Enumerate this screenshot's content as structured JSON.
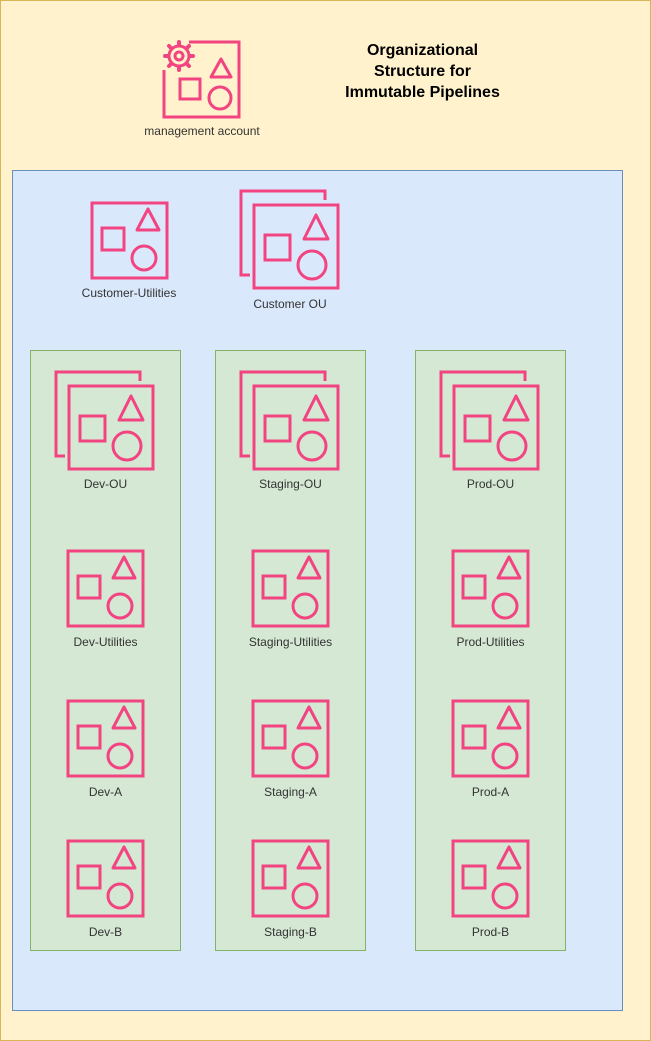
{
  "title": "Organizational Structure for Immutable Pipelines",
  "colors": {
    "outer_fill": "#fff2cc",
    "outer_border": "#d6b656",
    "ou_fill": "#dae8fc",
    "ou_border": "#6c8ebf",
    "column_fill": "#d5e8d4",
    "column_border": "#82b366",
    "icon": "#f34482"
  },
  "management": {
    "label": "management account",
    "icon": "organizations-management-account-icon"
  },
  "customer": {
    "utilities_label": "Customer-Utilities",
    "ou_label": "Customer OU"
  },
  "columns": [
    {
      "ou": "Dev-OU",
      "accounts": [
        "Dev-Utilities",
        "Dev-A",
        "Dev-B"
      ]
    },
    {
      "ou": "Staging-OU",
      "accounts": [
        "Staging-Utilities",
        "Staging-A",
        "Staging-B"
      ]
    },
    {
      "ou": "Prod-OU",
      "accounts": [
        "Prod-Utilities",
        "Prod-A",
        "Prod-B"
      ]
    }
  ]
}
